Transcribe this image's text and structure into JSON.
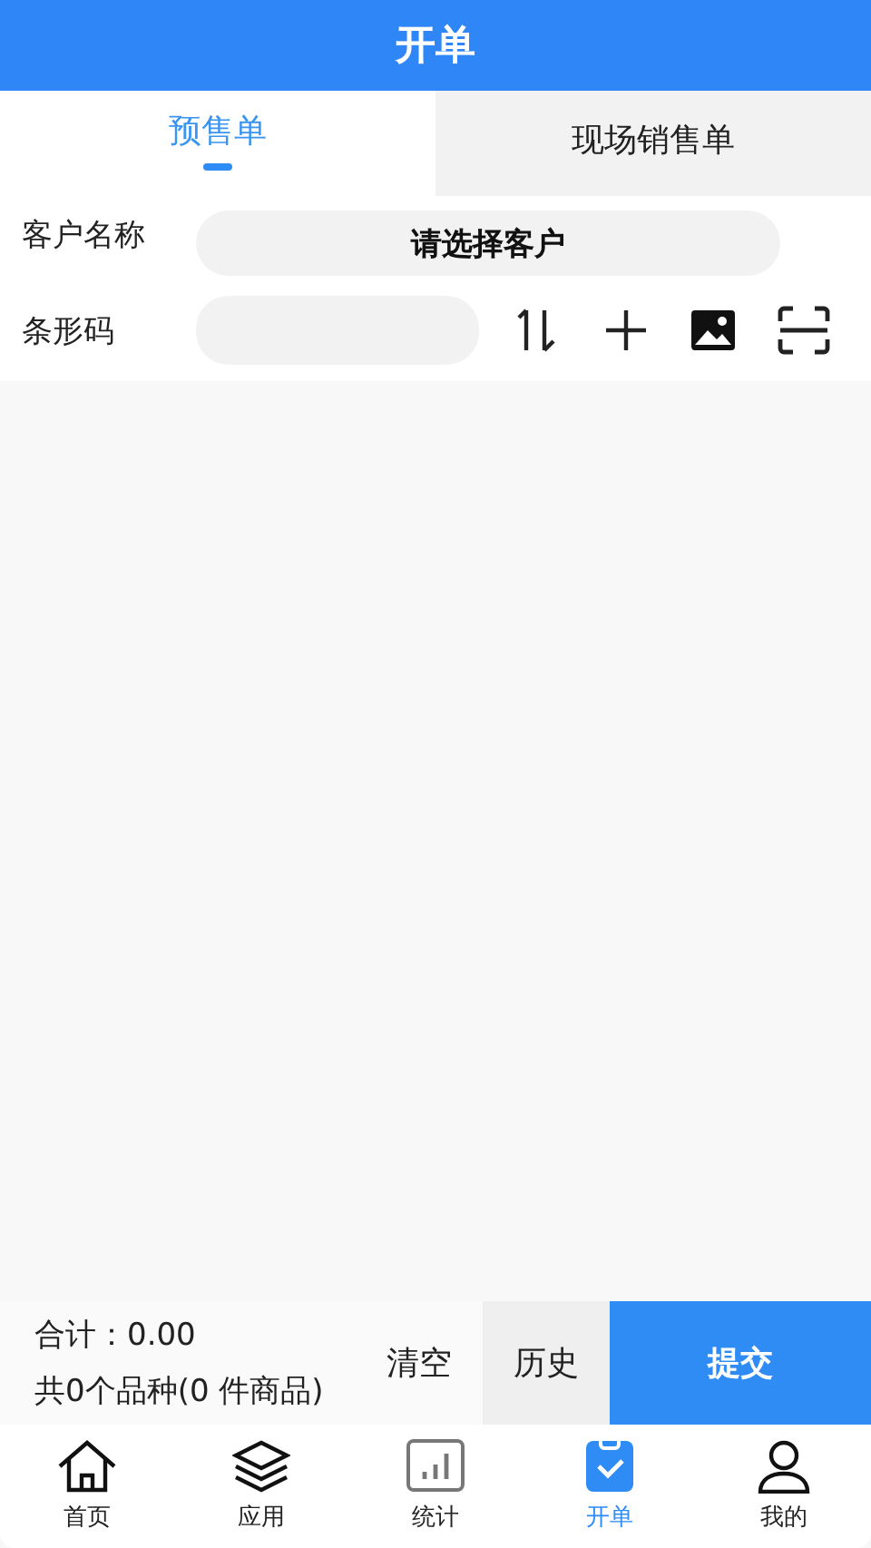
{
  "header": {
    "title": "开单"
  },
  "tabs": [
    {
      "label": "预售单",
      "selected": true
    },
    {
      "label": "现场销售单",
      "selected": false
    }
  ],
  "form": {
    "customer_label": "客户名称",
    "customer_button": "请选择客户",
    "barcode_label": "条形码"
  },
  "summary": {
    "total": "合计：0.00",
    "count": "共0个品种(0 件商品)"
  },
  "actions": {
    "clear": "清空",
    "history": "历史",
    "submit": "提交"
  },
  "nav": [
    {
      "label": "首页",
      "selected": false
    },
    {
      "label": "应用",
      "selected": false
    },
    {
      "label": "统计",
      "selected": false
    },
    {
      "label": "开单",
      "selected": true
    },
    {
      "label": "我的",
      "selected": false
    }
  ]
}
